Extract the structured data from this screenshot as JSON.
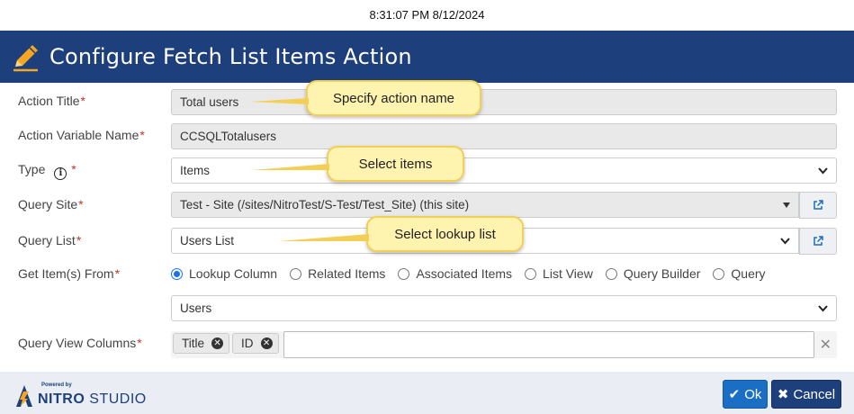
{
  "timestamp": "8:31:07 PM 8/12/2024",
  "dialog": {
    "title": "Configure Fetch List Items Action"
  },
  "form": {
    "action_title": {
      "label": "Action Title",
      "value": "Total users"
    },
    "action_variable_name": {
      "label": "Action Variable Name",
      "value": "CCSQLTotalusers"
    },
    "type": {
      "label": "Type",
      "value": "Items"
    },
    "query_site": {
      "label": "Query Site",
      "value": "Test - Site (/sites/NitroTest/S-Test/Test_Site) (this site)"
    },
    "query_list": {
      "label": "Query List",
      "value": "Users List"
    },
    "get_items_from": {
      "label": "Get Item(s) From",
      "options": [
        "Lookup Column",
        "Related Items",
        "Associated Items",
        "List View",
        "Query Builder",
        "Query"
      ],
      "selected": "Lookup Column",
      "column_value": "Users"
    },
    "query_view_columns": {
      "label": "Query View Columns",
      "tags": [
        "Title",
        "ID"
      ]
    },
    "required_marker": "*"
  },
  "callouts": {
    "action_name": "Specify action name",
    "items": "Select items",
    "lookup_list": "Select lookup list"
  },
  "footer": {
    "powered_by": "Powered by",
    "brand_nitro": "NITRO",
    "brand_studio": "STUDIO",
    "ok_label": "Ok",
    "cancel_label": "Cancel"
  },
  "colors": {
    "header_bg": "#1d3f7c",
    "ok_bg": "#1a6fc4",
    "cancel_bg": "#1d3f7c",
    "callout_bg": "#fff3b0",
    "pencil": "#f5a623"
  },
  "icons": {
    "header": "pencil-icon",
    "type_help": "info-icon",
    "dropdown": "chevron-down-icon",
    "open_external": "external-link-icon",
    "tag_remove": "close-circle-icon",
    "clear": "close-icon",
    "ok": "check-icon",
    "cancel": "close-icon"
  }
}
